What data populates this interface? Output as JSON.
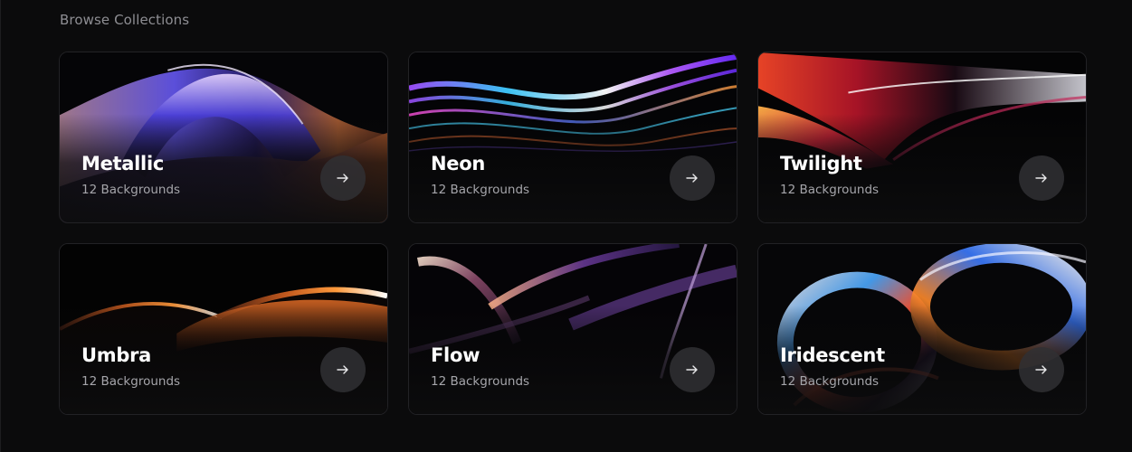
{
  "section": {
    "title": "Browse Collections"
  },
  "collections": [
    {
      "name": "Metallic",
      "count": "12 Backgrounds",
      "icon": "arrow-right-icon"
    },
    {
      "name": "Neon",
      "count": "12 Backgrounds",
      "icon": "arrow-right-icon"
    },
    {
      "name": "Twilight",
      "count": "12 Backgrounds",
      "icon": "arrow-right-icon"
    },
    {
      "name": "Umbra",
      "count": "12 Backgrounds",
      "icon": "arrow-right-icon"
    },
    {
      "name": "Flow",
      "count": "12 Backgrounds",
      "icon": "arrow-right-icon"
    },
    {
      "name": "Iridescent",
      "count": "12 Backgrounds",
      "icon": "arrow-right-icon"
    }
  ],
  "colors": {
    "background": "#0b0b0c",
    "card_border": "#222225",
    "title_text": "#8e8e93",
    "subtext": "#a5a5aa",
    "arrow_button": "#303034"
  }
}
